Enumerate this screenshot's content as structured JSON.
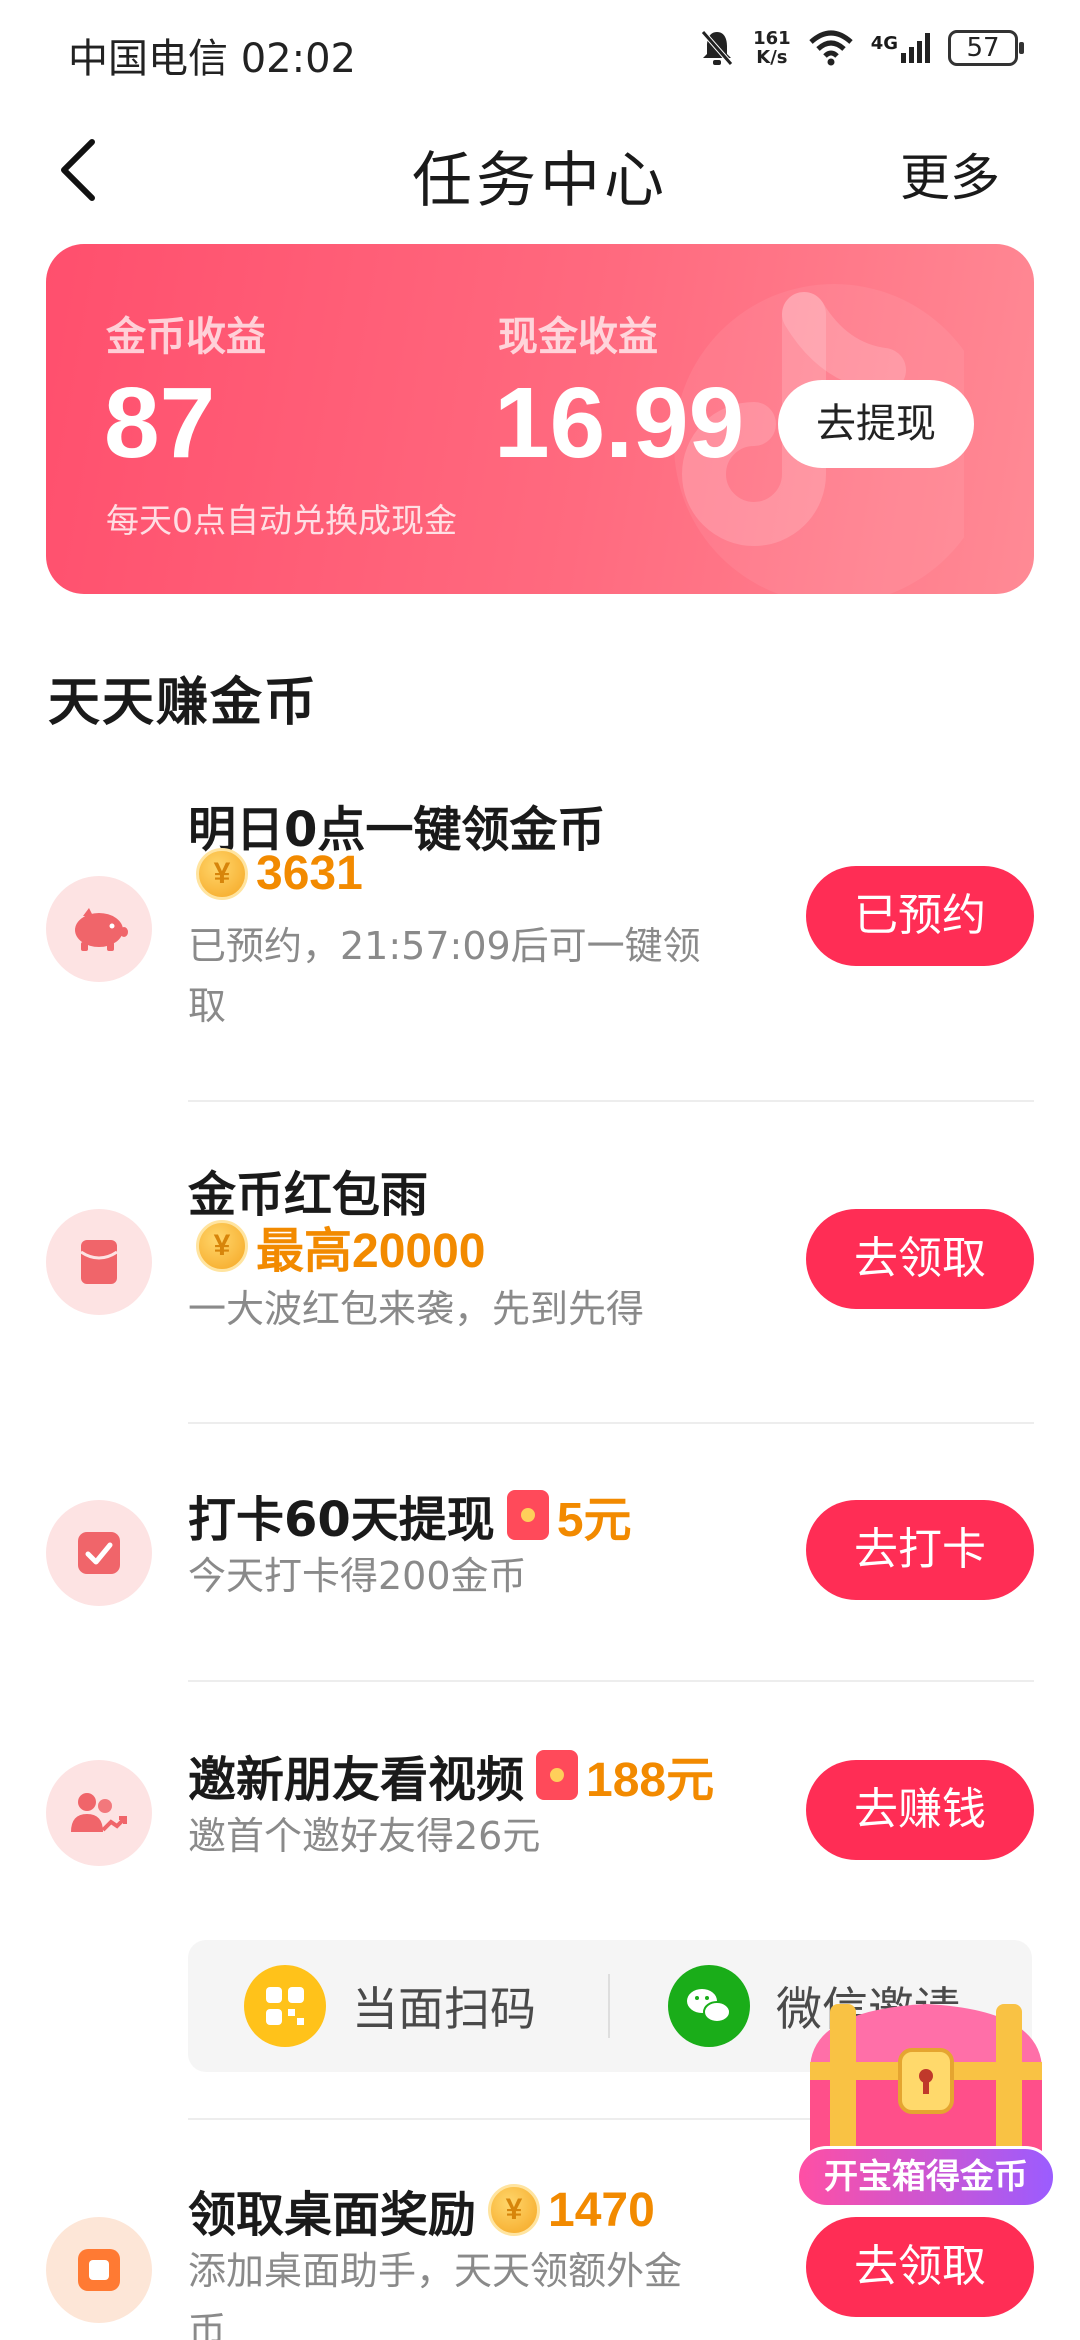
{
  "status_bar": {
    "carrier_time": "中国电信 02:02",
    "speed_top": "161",
    "speed_bottom": "K/s",
    "network": "4G",
    "battery": "57"
  },
  "header": {
    "title": "任务中心",
    "more": "更多"
  },
  "earnings": {
    "coin_label": "金币收益",
    "coin_value": "87",
    "cash_label": "现金收益",
    "cash_value": "16.99",
    "withdraw": "去提现",
    "note": "每天0点自动兑换成现金"
  },
  "section_title": "天天赚金币",
  "tasks": [
    {
      "title": "明日0点一键领金币",
      "reward": "3631",
      "desc_line1": "已预约，21:57:09后可一键领",
      "desc_line2": "取",
      "button": "已预约"
    },
    {
      "title": "金币红包雨",
      "reward": "最高20000",
      "desc": "一大波红包来袭，先到先得",
      "button": "去领取"
    },
    {
      "title": "打卡60天提现",
      "reward": "5元",
      "desc": "今天打卡得200金币",
      "button": "去打卡"
    },
    {
      "title": "邀新朋友看视频",
      "reward": "188元",
      "desc": "邀首个邀好友得26元",
      "button": "去赚钱"
    },
    {
      "title": "领取桌面奖励",
      "reward": "1470",
      "desc_line1": "添加桌面助手，天天领额外金",
      "desc_line2": "币",
      "button": "去领取"
    }
  ],
  "invite": {
    "scan": "当面扫码",
    "wechat": "微信邀请"
  },
  "chest": {
    "label": "开宝箱得金币"
  },
  "colors": {
    "accent": "#ff2d55",
    "reward": "#f28a00",
    "card_start": "#ff4f6d",
    "card_end": "#ff8a95"
  }
}
